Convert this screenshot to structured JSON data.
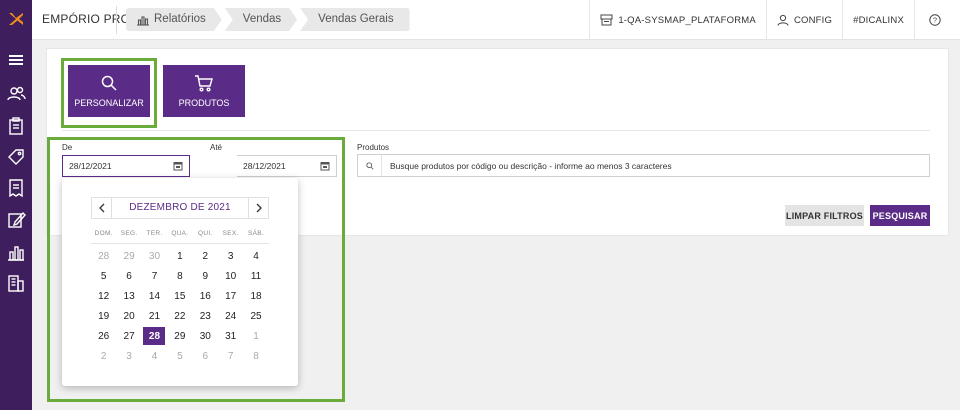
{
  "colors": {
    "brand_purple": "#5b2c87",
    "sidebar": "#3e1e5c",
    "highlight_green": "#6aac3c",
    "logo_orange": "#f28c1e"
  },
  "app": {
    "brand": "EMPÓRIO PRO"
  },
  "breadcrumbs": [
    {
      "label": "Relatórios",
      "icon": "bar-chart-icon"
    },
    {
      "label": "Vendas"
    },
    {
      "label": "Vendas Gerais"
    }
  ],
  "topbar": {
    "platform": "1-QA-SYSMAP_PLATAFORMA",
    "config": "CONFIG",
    "hashtag": "#DICALINX",
    "help": "?"
  },
  "sidebar": {
    "items": [
      {
        "icon": "menu-icon"
      },
      {
        "icon": "users-icon"
      },
      {
        "icon": "clipboard-icon"
      },
      {
        "icon": "tag-icon"
      },
      {
        "icon": "receipt-icon"
      },
      {
        "icon": "edit-icon"
      },
      {
        "icon": "bar-chart-icon"
      },
      {
        "icon": "building-icon"
      }
    ]
  },
  "tiles": {
    "personalizar": "PERSONALIZAR",
    "produtos": "PRODUTOS"
  },
  "filters": {
    "de_label": "De",
    "de_value": "28/12/2021",
    "ate_label": "Até",
    "ate_value": "28/12/2021",
    "produtos_label": "Produtos",
    "produtos_placeholder": "Busque produtos por código ou descrição - informe ao menos 3 caracteres"
  },
  "buttons": {
    "limpar": "LIMPAR FILTROS",
    "pesquisar": "PESQUISAR"
  },
  "datepicker": {
    "month_label": "DEZEMBRO DE 2021",
    "prev": "‹",
    "next": "›",
    "weekdays": [
      "DOM.",
      "SEG.",
      "TER.",
      "QUA.",
      "QUI.",
      "SEX.",
      "SÁB."
    ],
    "selected_day": "28",
    "weeks": [
      [
        {
          "d": "28",
          "m": true
        },
        {
          "d": "29",
          "m": true
        },
        {
          "d": "30",
          "m": true
        },
        {
          "d": "1"
        },
        {
          "d": "2"
        },
        {
          "d": "3"
        },
        {
          "d": "4"
        }
      ],
      [
        {
          "d": "5"
        },
        {
          "d": "6"
        },
        {
          "d": "7"
        },
        {
          "d": "8"
        },
        {
          "d": "9"
        },
        {
          "d": "10"
        },
        {
          "d": "11"
        }
      ],
      [
        {
          "d": "12"
        },
        {
          "d": "13"
        },
        {
          "d": "14"
        },
        {
          "d": "15"
        },
        {
          "d": "16"
        },
        {
          "d": "17"
        },
        {
          "d": "18"
        }
      ],
      [
        {
          "d": "19"
        },
        {
          "d": "20"
        },
        {
          "d": "21"
        },
        {
          "d": "22"
        },
        {
          "d": "23"
        },
        {
          "d": "24"
        },
        {
          "d": "25"
        }
      ],
      [
        {
          "d": "26"
        },
        {
          "d": "27"
        },
        {
          "d": "28",
          "s": true
        },
        {
          "d": "29"
        },
        {
          "d": "30"
        },
        {
          "d": "31"
        },
        {
          "d": "1",
          "m": true
        }
      ],
      [
        {
          "d": "2",
          "m": true
        },
        {
          "d": "3",
          "m": true
        },
        {
          "d": "4",
          "m": true
        },
        {
          "d": "5",
          "m": true
        },
        {
          "d": "6",
          "m": true
        },
        {
          "d": "7",
          "m": true
        },
        {
          "d": "8",
          "m": true
        }
      ]
    ]
  }
}
